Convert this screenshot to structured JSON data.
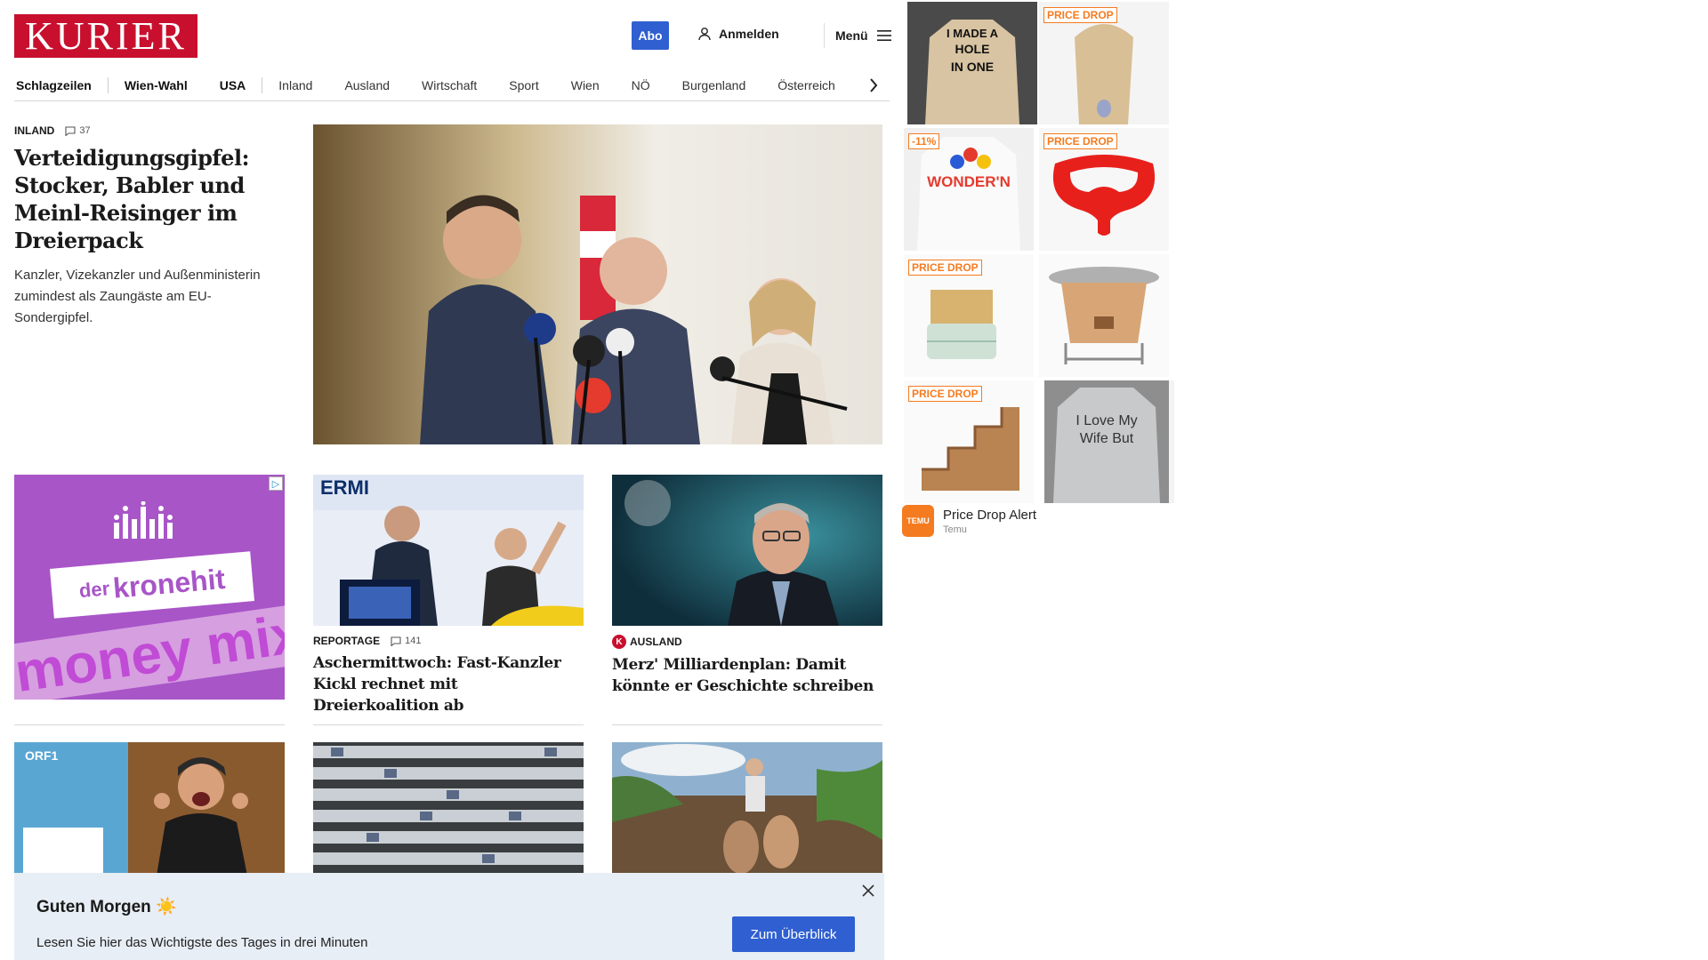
{
  "header": {
    "logo": "KURIER",
    "abo_label": "Abo",
    "login_label": "Anmelden",
    "menu_label": "Menü"
  },
  "nav": {
    "items": [
      "Schlagzeilen",
      "Wien-Wahl",
      "USA",
      "Inland",
      "Ausland",
      "Wirtschaft",
      "Sport",
      "Wien",
      "NÖ",
      "Burgenland",
      "Österreich"
    ]
  },
  "lead": {
    "kicker": "INLAND",
    "comments": "37",
    "title": "Verteidigungsgipfel: Stocker, Babler und Meinl-Reisinger im Dreierpack",
    "subtitle": "Kanzler, Vizekanzler und Außenministerin zumindest als Zaungäste am EU-Sondergipfel."
  },
  "ad_kronehit": {
    "brand_prefix": "der",
    "brand": "kronehit",
    "slogan": "money mix"
  },
  "cards": [
    {
      "kicker": "REPORTAGE",
      "comments": "141",
      "title": "Aschermittwoch: Fast-Kanzler Kickl rechnet mit Dreierkoalition ab"
    },
    {
      "kicker": "AUSLAND",
      "badge": "K",
      "title": "Merz' Milliardenplan: Damit könnte er Geschichte schreiben"
    }
  ],
  "notification": {
    "title": "Guten Morgen ☀️",
    "text": "Lesen Sie hier das Wichtigste des Tages in drei Minuten",
    "button": "Zum Überblick"
  },
  "side_ad": {
    "tags": [
      "PRICE DROP",
      "-11%",
      "PRICE DROP",
      "PRICE DROP",
      "PRICE DROP"
    ],
    "shirt1": [
      "I MADE A",
      "HOLE",
      "IN ONE"
    ],
    "shirt2": [
      "WONDER'N"
    ],
    "shirt3": [
      "I Love My",
      "Wife But"
    ],
    "footer_title": "Price Drop Alert",
    "footer_sub": "Temu",
    "logo_text": "TEMU"
  },
  "colors": {
    "brand_red": "#c8102e",
    "accent_blue": "#2f5fd0",
    "temu_orange": "#f47b20"
  }
}
